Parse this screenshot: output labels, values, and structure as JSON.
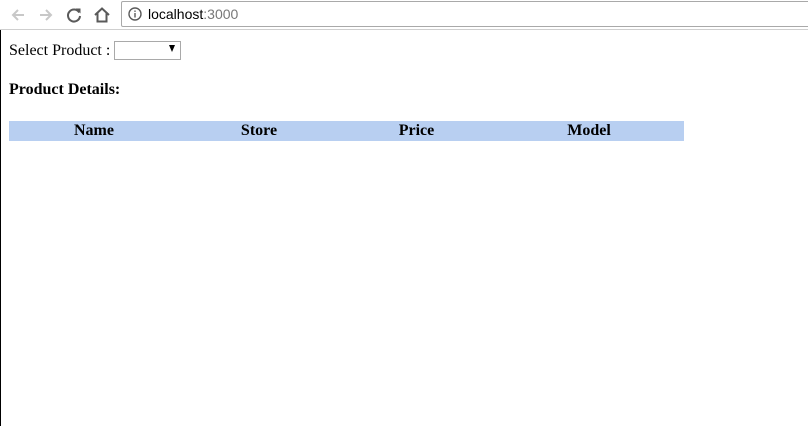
{
  "browser": {
    "url_host": "localhost",
    "url_port": ":3000",
    "icons": {
      "back": "back-arrow-icon",
      "forward": "forward-arrow-icon",
      "reload": "reload-icon",
      "home": "home-icon",
      "info": "info-icon"
    }
  },
  "page": {
    "select_label": "Select Product :",
    "select_value": "",
    "details_heading": "Product Details:",
    "table": {
      "header_color": "#b8cff1",
      "columns": [
        "Name",
        "Store",
        "Price",
        "Model"
      ],
      "rows": []
    }
  }
}
